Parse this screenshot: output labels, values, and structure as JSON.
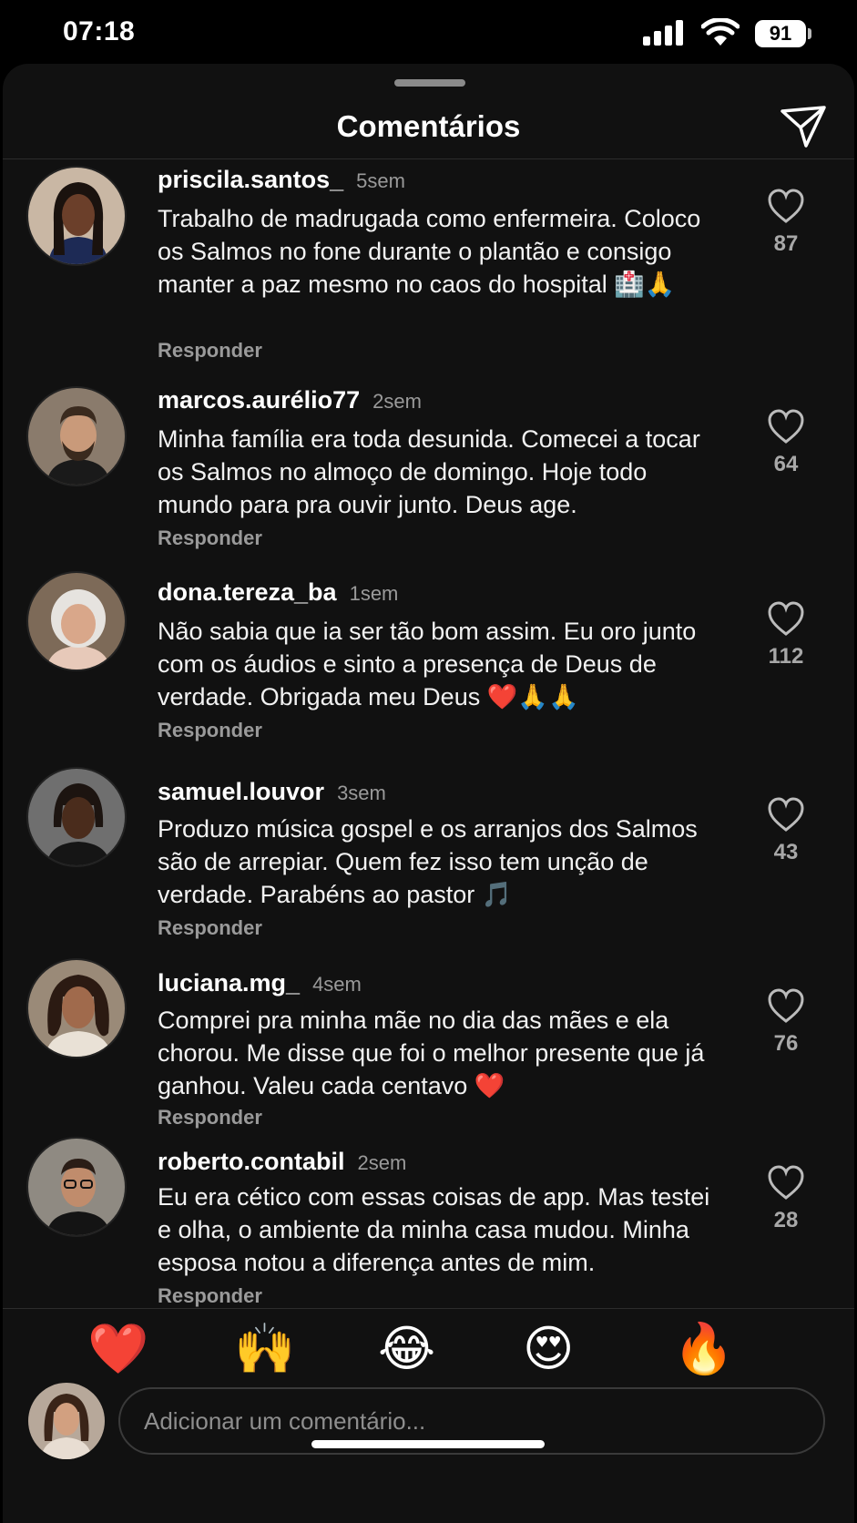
{
  "status_bar": {
    "time": "07:18",
    "battery": "91"
  },
  "sheet": {
    "title": "Comentários"
  },
  "comments": [
    {
      "user": "priscila.santos_",
      "time": "5sem",
      "text": "Trabalho de madrugada como enfermeira. Coloco os Salmos no fone durante o plantão e consigo manter a paz mesmo no caos do hospital 🏥🙏",
      "reply": "Responder",
      "likes": "87"
    },
    {
      "user": "marcos.aurélio77",
      "time": "2sem",
      "text": "Minha família era toda desunida. Comecei a tocar os Salmos no almoço de domingo. Hoje todo mundo para pra ouvir junto. Deus age.",
      "reply": "Responder",
      "likes": "64"
    },
    {
      "user": "dona.tereza_ba",
      "time": "1sem",
      "text": "Não sabia que ia ser tão bom assim. Eu oro junto com os áudios e sinto a presença de Deus de verdade. Obrigada meu Deus ❤️🙏🙏",
      "reply": "Responder",
      "likes": "112"
    },
    {
      "user": "samuel.louvor",
      "time": "3sem",
      "text": "Produzo música gospel e os arranjos dos Salmos são de arrepiar. Quem fez isso tem unção de verdade. Parabéns ao pastor 🎵",
      "reply": "Responder",
      "likes": "43"
    },
    {
      "user": "luciana.mg_",
      "time": "4sem",
      "text": "Comprei pra minha mãe no dia das mães e ela chorou. Me disse que foi o melhor presente que já ganhou. Valeu cada centavo ❤️",
      "reply": "Responder",
      "likes": "76"
    },
    {
      "user": "roberto.contabil",
      "time": "2sem",
      "text": "Eu era cético com essas coisas de app. Mas testei e olha, o ambiente da minha casa mudou. Minha esposa notou a diferença antes de mim.",
      "reply": "Responder",
      "likes": "28"
    }
  ],
  "quick_reactions": [
    "❤️",
    "🙌",
    "😂",
    "😍",
    "🔥"
  ],
  "composer": {
    "placeholder": "Adicionar um comentário..."
  },
  "colors": {
    "background": "#000000",
    "sheet": "#111111",
    "secondary_text": "#9a9a9a",
    "heart_red": "#ff2d3c"
  },
  "icons": [
    "signal-icon",
    "wifi-icon",
    "battery-icon",
    "send-icon",
    "heart-outline-icon"
  ]
}
